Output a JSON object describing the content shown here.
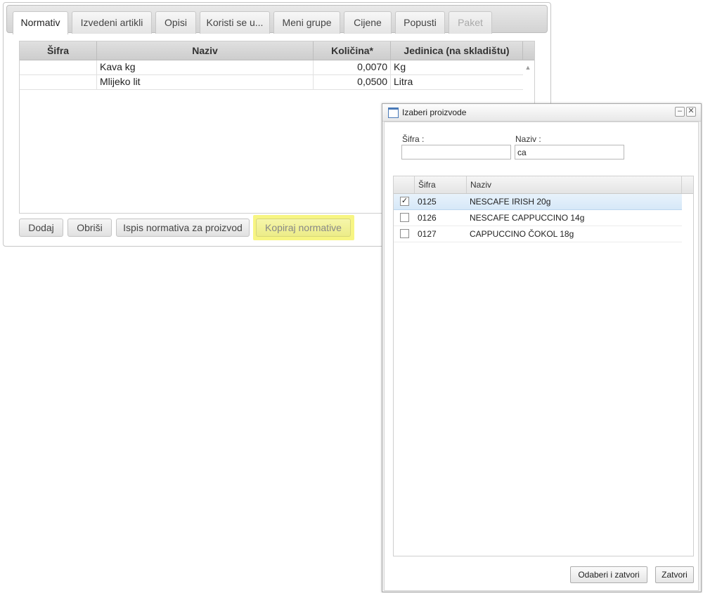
{
  "tabs": [
    {
      "label": "Normativ",
      "state": "active"
    },
    {
      "label": "Izvedeni artikli",
      "state": "normal"
    },
    {
      "label": "Opisi",
      "state": "normal"
    },
    {
      "label": "Koristi se u...",
      "state": "normal"
    },
    {
      "label": "Meni grupe",
      "state": "normal"
    },
    {
      "label": "Cijene",
      "state": "normal"
    },
    {
      "label": "Popusti",
      "state": "normal"
    },
    {
      "label": "Paket",
      "state": "disabled"
    }
  ],
  "grid": {
    "columns": [
      "Šifra",
      "Naziv",
      "Količina*",
      "Jedinica (na skladištu)"
    ],
    "rows": [
      {
        "sifra": "",
        "naziv": "Kava kg",
        "kolicina": "0,0070",
        "jedinica": "Kg"
      },
      {
        "sifra": "",
        "naziv": "Mlijeko lit",
        "kolicina": "0,0500",
        "jedinica": "Litra"
      }
    ]
  },
  "buttons": {
    "dodaj": "Dodaj",
    "obrisi": "Obriši",
    "ispis": "Ispis normativa za proizvod",
    "kopiraj": "Kopiraj normative"
  },
  "colors": {
    "highlight": "#f6f36d",
    "selected_row": "#d6e8f8",
    "window_icon": "#4a7ab8"
  },
  "dialog": {
    "title": "Izaberi proizvode",
    "filters": {
      "sifra_label": "Šifra :",
      "sifra_value": "",
      "naziv_label": "Naziv :",
      "naziv_value": "ca"
    },
    "columns": [
      "Šifra",
      "Naziv"
    ],
    "rows": [
      {
        "checked": true,
        "sifra": "0125",
        "naziv": "NESCAFE IRISH 20g"
      },
      {
        "checked": false,
        "sifra": "0126",
        "naziv": "NESCAFE CAPPUCCINO 14g"
      },
      {
        "checked": false,
        "sifra": "0127",
        "naziv": "CAPPUCCINO ČOKOL 18g"
      }
    ],
    "buttons": {
      "select_close": "Odaberi i zatvori",
      "close": "Zatvori"
    }
  }
}
